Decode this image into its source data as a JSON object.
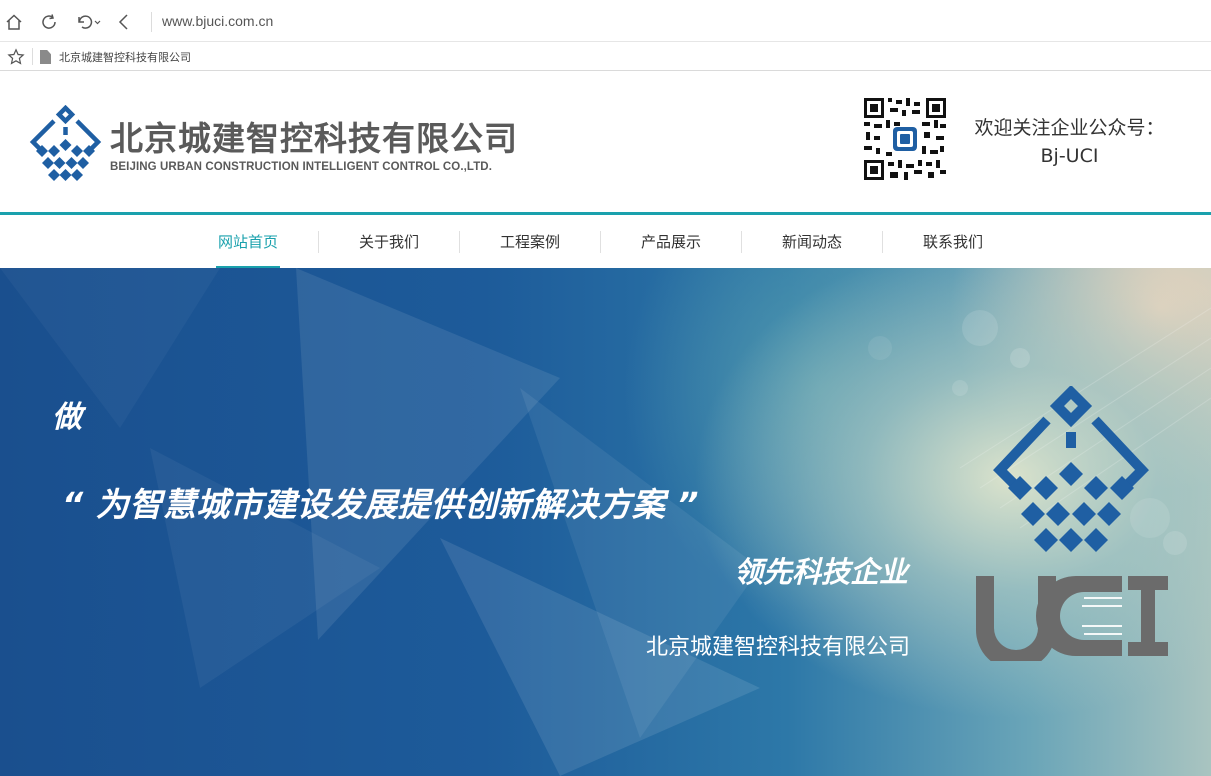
{
  "browser": {
    "url": "www.bjuci.com.cn",
    "bookmark_title": "北京城建智控科技有限公司"
  },
  "header": {
    "company_name_cn": "北京城建智控科技有限公司",
    "company_name_en": "BEIJING URBAN CONSTRUCTION INTELLIGENT CONTROL CO.,LTD.",
    "follow_text": "欢迎关注企业公众号：",
    "wechat_id": "Bj-UCI"
  },
  "nav": {
    "items": [
      {
        "label": "网站首页",
        "active": true
      },
      {
        "label": "关于我们",
        "active": false
      },
      {
        "label": "工程案例",
        "active": false
      },
      {
        "label": "产品展示",
        "active": false
      },
      {
        "label": "新闻动态",
        "active": false
      },
      {
        "label": "联系我们",
        "active": false
      }
    ]
  },
  "banner": {
    "line1": "做",
    "line2": "“ 为智慧城市建设发展提供创新解决方案 ”",
    "line3": "领先科技企业",
    "line4": "北京城建智控科技有限公司",
    "brand": "UCI"
  },
  "colors": {
    "accent": "#1aa1ad",
    "logo_blue": "#1f5fa3",
    "text_gray": "#5a5a5a"
  }
}
